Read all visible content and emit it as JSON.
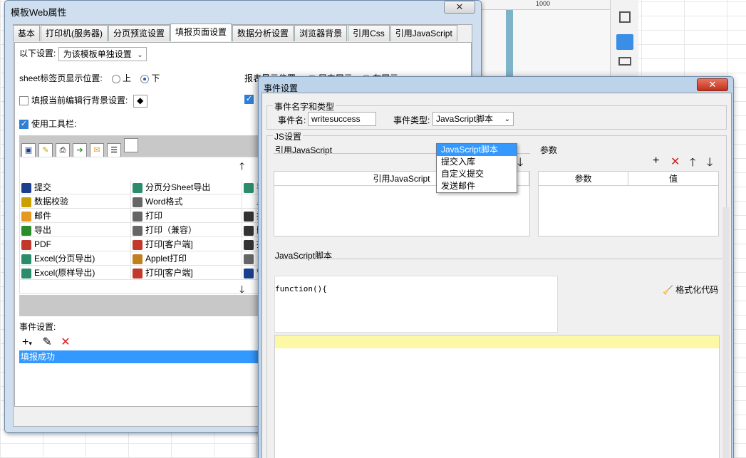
{
  "background": {
    "ruler_label": "1000"
  },
  "win1": {
    "title": "模板Web属性",
    "close_label": "✕",
    "tabs": [
      "基本",
      "打印机(服务器)",
      "分页预览设置",
      "填报页面设置",
      "数据分析设置",
      "浏览器背景",
      "引用Css",
      "引用JavaScript"
    ],
    "active_tab_index": 3,
    "settings_label": "以下设置:",
    "settings_value": "为该模板单独设置",
    "sheet_pos_label": "sheet标签页显示位置:",
    "radio_up": "上",
    "radio_down": "下",
    "report_display_label": "报表显示位置:",
    "report_center": "居中展示",
    "report_left": "左展示",
    "fill_bg_label": "填报当前编辑行背景设置:",
    "use_toolbar_label": "使用工具栏:",
    "toolbar_items": [
      [
        "提交",
        "分页分Sheet导出",
        "导"
      ],
      [
        "数据校验",
        "Word格式",
        "显"
      ],
      [
        "邮件",
        "打印",
        "插"
      ],
      [
        "导出",
        "打印（兼容）",
        "删"
      ],
      [
        "PDF",
        "打印[客户端]",
        "打"
      ],
      [
        "Excel(分页导出)",
        "Applet打印",
        "自"
      ],
      [
        "Excel(原样导出)",
        "打印[客户端]",
        "暂"
      ]
    ],
    "events_label": "事件设置:",
    "events": [
      "填报成功"
    ]
  },
  "win2": {
    "title": "事件设置",
    "close_label": "✕",
    "group_name_type": "事件名字和类型",
    "event_name_label": "事件名:",
    "event_name_value": "writesuccess",
    "event_type_label": "事件类型:",
    "event_type_value": "JavaScript脚本",
    "dropdown_options": [
      "JavaScript脚本",
      "提交入库",
      "自定义提交",
      "发送邮件"
    ],
    "js_group": "JS设置",
    "ref_js_label": "引用JavaScript",
    "ref_js_col": "引用JavaScript",
    "params_label": "参数",
    "params_cols": [
      "参数",
      "值"
    ],
    "js_script_label": "JavaScript脚本",
    "function_text": "function(){",
    "format_code": "格式化代码"
  }
}
